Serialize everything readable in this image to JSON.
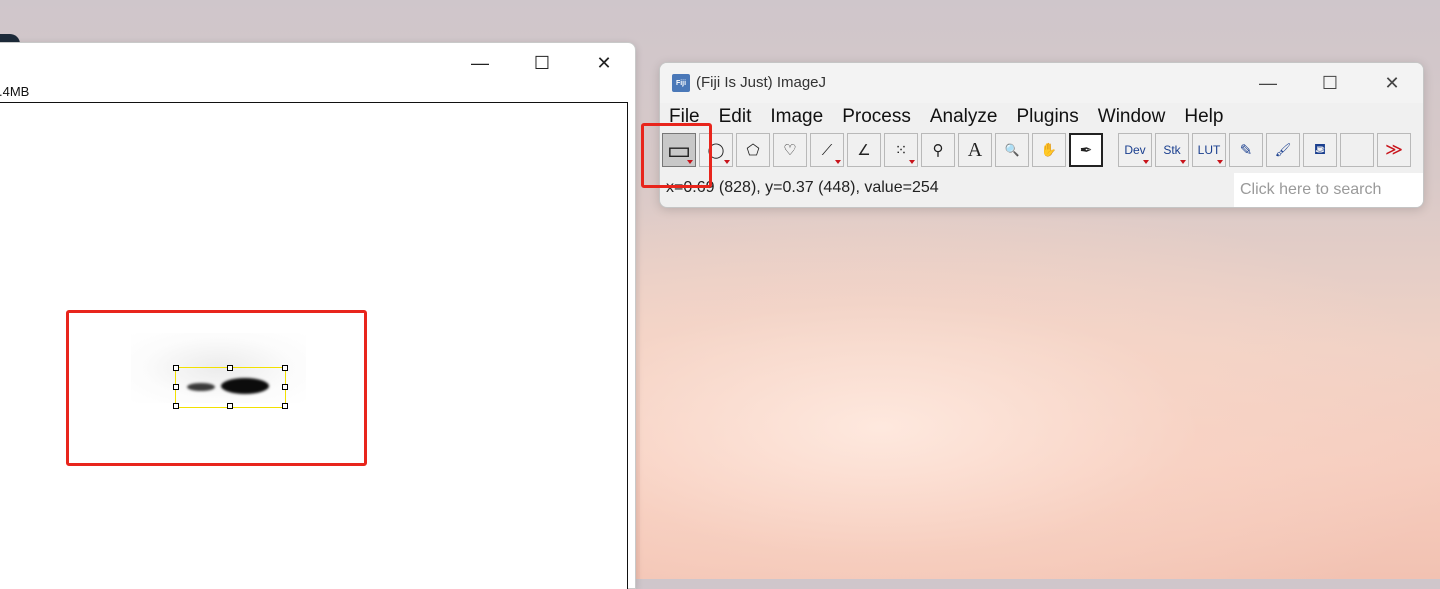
{
  "image_window": {
    "subtitle": ".4MB",
    "controls": {
      "minimize": "—",
      "maximize": "☐",
      "close": "✕"
    }
  },
  "imagej": {
    "logo": "Fiji",
    "title": "(Fiji Is Just) ImageJ",
    "controls": {
      "minimize": "—",
      "maximize": "☐",
      "close": "✕"
    },
    "menu": [
      "File",
      "Edit",
      "Image",
      "Process",
      "Analyze",
      "Plugins",
      "Window",
      "Help"
    ],
    "tools": [
      {
        "name": "rectangle-tool",
        "glyph": "▭"
      },
      {
        "name": "oval-tool",
        "glyph": "◯"
      },
      {
        "name": "polygon-tool",
        "glyph": "⬠"
      },
      {
        "name": "freehand-tool",
        "glyph": "♡"
      },
      {
        "name": "line-tool",
        "glyph": "⟋"
      },
      {
        "name": "angle-tool",
        "glyph": "∠"
      },
      {
        "name": "point-tool",
        "glyph": "⁙"
      },
      {
        "name": "wand-tool",
        "glyph": "⚲"
      },
      {
        "name": "text-tool",
        "glyph": "A"
      },
      {
        "name": "magnifier-tool",
        "glyph": "🔍"
      },
      {
        "name": "hand-tool",
        "glyph": "✋"
      },
      {
        "name": "color-picker-tool",
        "glyph": "✒"
      },
      {
        "name": "dev-menu",
        "glyph": "Dev"
      },
      {
        "name": "stk-menu",
        "glyph": "Stk"
      },
      {
        "name": "lut-menu",
        "glyph": "LUT"
      },
      {
        "name": "pencil-tool",
        "glyph": "✎"
      },
      {
        "name": "brush-tool",
        "glyph": "🖌"
      },
      {
        "name": "flood-fill-tool",
        "glyph": "⛾"
      },
      {
        "name": "blank-slot",
        "glyph": ""
      },
      {
        "name": "more-tools",
        "glyph": "≫"
      }
    ],
    "status": "x=0.69 (828), y=0.37 (448), value=254",
    "search_placeholder": "Click here to search"
  },
  "colors": {
    "highlight": "#e8251c",
    "roi": "#f2e100"
  }
}
